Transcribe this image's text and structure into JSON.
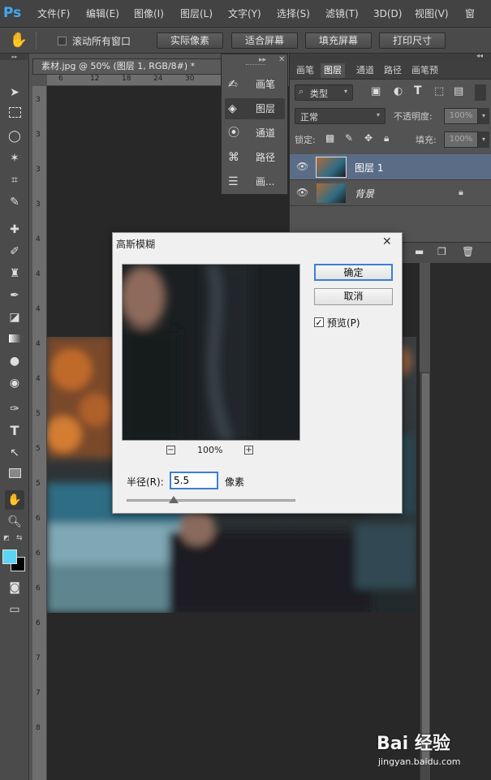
{
  "app": {
    "logo": "Ps"
  },
  "menu": [
    "文件(F)",
    "编辑(E)",
    "图像(I)",
    "图层(L)",
    "文字(Y)",
    "选择(S)",
    "滤镜(T)",
    "3D(D)",
    "视图(V)",
    "窗"
  ],
  "options": {
    "scroll_all": "滚动所有窗口",
    "btn_actual": "实际像素",
    "btn_fit": "适合屏幕",
    "btn_fill": "填充屏幕",
    "btn_print": "打印尺寸"
  },
  "document": {
    "tab_title": "素材.jpg @ 50% (图层 1, RGB/8#) *",
    "ruler_top": [
      "6",
      "12",
      "18",
      "24",
      "30"
    ],
    "ruler_left": [
      "3",
      "3",
      "3",
      "3",
      "4",
      "4",
      "4",
      "4",
      "4",
      "5",
      "5",
      "5",
      "6",
      "6",
      "6",
      "6",
      "7",
      "7",
      "8"
    ]
  },
  "mini_panel": {
    "items": [
      {
        "icon": "brush-icon",
        "label": "画笔"
      },
      {
        "icon": "layers-icon",
        "label": "图层"
      },
      {
        "icon": "channels-icon",
        "label": "通道"
      },
      {
        "icon": "paths-icon",
        "label": "路径"
      },
      {
        "icon": "adjust-icon",
        "label": "画..."
      }
    ]
  },
  "layers_panel": {
    "tabs": [
      "画笔",
      "图层",
      "通道",
      "路径",
      "画笔预"
    ],
    "filter_label": "类型",
    "blend_mode": "正常",
    "opacity_label": "不透明度:",
    "opacity_value": "100%",
    "lock_label": "锁定:",
    "fill_label": "填充:",
    "fill_value": "100%",
    "layers": [
      {
        "name": "图层 1",
        "selected": true
      },
      {
        "name": "背景",
        "selected": false
      }
    ]
  },
  "dialog": {
    "title": "高斯模糊",
    "ok": "确定",
    "cancel": "取消",
    "preview_label": "预览(P)",
    "preview_checked": true,
    "zoom": "100%",
    "radius_label": "半径(R):",
    "radius_value": "5.5",
    "unit": "像素",
    "radius_slider_fraction": 0.28
  },
  "watermark": {
    "brand": "Bai 经验",
    "url": "jingyan.baidu.com"
  },
  "colors": {
    "foreground": "#5bd4f4",
    "background": "#000000",
    "accent": "#3fa9f5"
  }
}
